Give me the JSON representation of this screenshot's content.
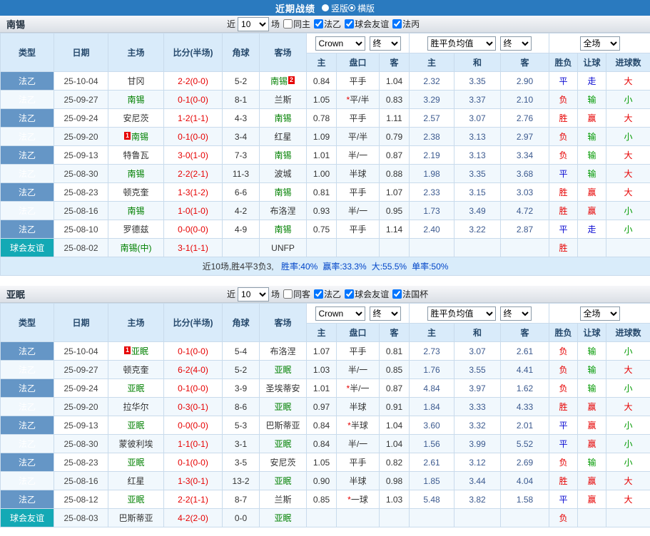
{
  "top_bar": {
    "title": "近期战绩",
    "radios": [
      {
        "label": "竖版",
        "selected": false
      },
      {
        "label": "横版",
        "selected": true
      }
    ]
  },
  "colors": {
    "topbar_bg": "#2a7abf",
    "league_type_bg": "#6596c6",
    "friendly_type_bg": "#14a9b5",
    "team_green": "#008000",
    "score_red": "#e60000",
    "header_bg": "#d9ebfa",
    "summary_bg": "#d9ecfa"
  },
  "result_colors": {
    "胜": "#e60000",
    "负": "#e60000",
    "平": "#0a0ad2",
    "赢": "#e60000",
    "输": "#009900",
    "走": "#0a0ad2",
    "大": "#e60000",
    "小": "#009900"
  },
  "table": {
    "left_headers": [
      "类型",
      "日期",
      "主场",
      "比分(半场)",
      "角球",
      "客场"
    ],
    "odds_headers": [
      "主",
      "盘口",
      "客"
    ],
    "avg_headers": [
      "主",
      "和",
      "客"
    ],
    "result_headers": [
      "胜负",
      "让球",
      "进球数"
    ],
    "selects": {
      "source": "Crown",
      "final1": "终",
      "avg": "胜平负均值",
      "final2": "终",
      "scope": "全场"
    }
  },
  "sections": [
    {
      "team": "南锡",
      "near": "近",
      "count": "10",
      "unit": "场",
      "checkboxes": [
        {
          "label": "同主",
          "checked": false
        },
        {
          "label": "法乙",
          "checked": true
        },
        {
          "label": "球会友谊",
          "checked": true
        },
        {
          "label": "法丙",
          "checked": true
        }
      ],
      "rows": [
        {
          "type": "法乙",
          "friendly": false,
          "date": "25-10-04",
          "home": {
            "text": "甘冈",
            "team": false
          },
          "score": "2-2(0-0)",
          "corner": "5-2",
          "away": {
            "text": "南锡",
            "team": true,
            "badge": "2",
            "badge_pos": "after"
          },
          "odds": [
            "0.84",
            "平手",
            "1.04"
          ],
          "avg": [
            "2.32",
            "3.35",
            "2.90"
          ],
          "result": "平",
          "handicap": "走",
          "goals": "大"
        },
        {
          "type": "法乙",
          "friendly": false,
          "date": "25-09-27",
          "home": {
            "text": "南锡",
            "team": true
          },
          "score": "0-1(0-0)",
          "corner": "8-1",
          "away": {
            "text": "兰斯",
            "team": false
          },
          "odds": [
            "1.05",
            "*平/半",
            "0.83"
          ],
          "avg": [
            "3.29",
            "3.37",
            "2.10"
          ],
          "result": "负",
          "handicap": "输",
          "goals": "小"
        },
        {
          "type": "法乙",
          "friendly": false,
          "date": "25-09-24",
          "home": {
            "text": "安尼茨",
            "team": false
          },
          "score": "1-2(1-1)",
          "corner": "4-3",
          "away": {
            "text": "南锡",
            "team": true
          },
          "odds": [
            "0.78",
            "平手",
            "1.11"
          ],
          "avg": [
            "2.57",
            "3.07",
            "2.76"
          ],
          "result": "胜",
          "handicap": "赢",
          "goals": "大"
        },
        {
          "type": "法乙",
          "friendly": false,
          "date": "25-09-20",
          "home": {
            "text": "南锡",
            "team": true,
            "badge": "1",
            "badge_pos": "before"
          },
          "score": "0-1(0-0)",
          "corner": "3-4",
          "away": {
            "text": "红星",
            "team": false
          },
          "odds": [
            "1.09",
            "平/半",
            "0.79"
          ],
          "avg": [
            "2.38",
            "3.13",
            "2.97"
          ],
          "result": "负",
          "handicap": "输",
          "goals": "小"
        },
        {
          "type": "法乙",
          "friendly": false,
          "date": "25-09-13",
          "home": {
            "text": "特鲁瓦",
            "team": false
          },
          "score": "3-0(1-0)",
          "corner": "7-3",
          "away": {
            "text": "南锡",
            "team": true
          },
          "odds": [
            "1.01",
            "半/一",
            "0.87"
          ],
          "avg": [
            "2.19",
            "3.13",
            "3.34"
          ],
          "result": "负",
          "handicap": "输",
          "goals": "大"
        },
        {
          "type": "法乙",
          "friendly": false,
          "date": "25-08-30",
          "home": {
            "text": "南锡",
            "team": true
          },
          "score": "2-2(2-1)",
          "corner": "11-3",
          "away": {
            "text": "波城",
            "team": false
          },
          "odds": [
            "1.00",
            "半球",
            "0.88"
          ],
          "avg": [
            "1.98",
            "3.35",
            "3.68"
          ],
          "result": "平",
          "handicap": "输",
          "goals": "大"
        },
        {
          "type": "法乙",
          "friendly": false,
          "date": "25-08-23",
          "home": {
            "text": "顿克奎",
            "team": false
          },
          "score": "1-3(1-2)",
          "corner": "6-6",
          "away": {
            "text": "南锡",
            "team": true
          },
          "odds": [
            "0.81",
            "平手",
            "1.07"
          ],
          "avg": [
            "2.33",
            "3.15",
            "3.03"
          ],
          "result": "胜",
          "handicap": "赢",
          "goals": "大"
        },
        {
          "type": "法乙",
          "friendly": false,
          "date": "25-08-16",
          "home": {
            "text": "南锡",
            "team": true
          },
          "score": "1-0(1-0)",
          "corner": "4-2",
          "away": {
            "text": "布洛涅",
            "team": false
          },
          "odds": [
            "0.93",
            "半/一",
            "0.95"
          ],
          "avg": [
            "1.73",
            "3.49",
            "4.72"
          ],
          "result": "胜",
          "handicap": "赢",
          "goals": "小"
        },
        {
          "type": "法乙",
          "friendly": false,
          "date": "25-08-10",
          "home": {
            "text": "罗德兹",
            "team": false
          },
          "score": "0-0(0-0)",
          "corner": "4-9",
          "away": {
            "text": "南锡",
            "team": true
          },
          "odds": [
            "0.75",
            "平手",
            "1.14"
          ],
          "avg": [
            "2.40",
            "3.22",
            "2.87"
          ],
          "result": "平",
          "handicap": "走",
          "goals": "小"
        },
        {
          "type": "球会友谊",
          "friendly": true,
          "date": "25-08-02",
          "home": {
            "text": "南锡(中)",
            "team": true
          },
          "score": "3-1(1-1)",
          "corner": "",
          "away": {
            "text": "UNFP",
            "team": false
          },
          "odds": [
            "",
            "",
            ""
          ],
          "avg": [
            "",
            "",
            ""
          ],
          "result": "胜",
          "handicap": "",
          "goals": ""
        }
      ],
      "summary": {
        "prefix": "近10场,胜4平3负3, ",
        "stats": [
          "胜率:40%",
          "赢率:33.3%",
          "大:55.5%",
          "单率:50%"
        ]
      }
    },
    {
      "team": "亚眠",
      "near": "近",
      "count": "10",
      "unit": "场",
      "checkboxes": [
        {
          "label": "同客",
          "checked": false
        },
        {
          "label": "法乙",
          "checked": true
        },
        {
          "label": "球会友谊",
          "checked": true
        },
        {
          "label": "法国杯",
          "checked": true
        }
      ],
      "rows": [
        {
          "type": "法乙",
          "friendly": false,
          "date": "25-10-04",
          "home": {
            "text": "亚眠",
            "team": true,
            "badge": "1",
            "badge_pos": "before"
          },
          "score": "0-1(0-0)",
          "corner": "5-4",
          "away": {
            "text": "布洛涅",
            "team": false
          },
          "odds": [
            "1.07",
            "平手",
            "0.81"
          ],
          "avg": [
            "2.73",
            "3.07",
            "2.61"
          ],
          "result": "负",
          "handicap": "输",
          "goals": "小"
        },
        {
          "type": "法乙",
          "friendly": false,
          "date": "25-09-27",
          "home": {
            "text": "顿克奎",
            "team": false
          },
          "score": "6-2(4-0)",
          "corner": "5-2",
          "away": {
            "text": "亚眠",
            "team": true
          },
          "odds": [
            "1.03",
            "半/一",
            "0.85"
          ],
          "avg": [
            "1.76",
            "3.55",
            "4.41"
          ],
          "result": "负",
          "handicap": "输",
          "goals": "大"
        },
        {
          "type": "法乙",
          "friendly": false,
          "date": "25-09-24",
          "home": {
            "text": "亚眠",
            "team": true
          },
          "score": "0-1(0-0)",
          "corner": "3-9",
          "away": {
            "text": "圣埃蒂安",
            "team": false
          },
          "odds": [
            "1.01",
            "*半/一",
            "0.87"
          ],
          "avg": [
            "4.84",
            "3.97",
            "1.62"
          ],
          "result": "负",
          "handicap": "输",
          "goals": "小"
        },
        {
          "type": "法乙",
          "friendly": false,
          "date": "25-09-20",
          "home": {
            "text": "拉华尔",
            "team": false
          },
          "score": "0-3(0-1)",
          "corner": "8-6",
          "away": {
            "text": "亚眠",
            "team": true
          },
          "odds": [
            "0.97",
            "半球",
            "0.91"
          ],
          "avg": [
            "1.84",
            "3.33",
            "4.33"
          ],
          "result": "胜",
          "handicap": "赢",
          "goals": "大"
        },
        {
          "type": "法乙",
          "friendly": false,
          "date": "25-09-13",
          "home": {
            "text": "亚眠",
            "team": true
          },
          "score": "0-0(0-0)",
          "corner": "5-3",
          "away": {
            "text": "巴斯蒂亚",
            "team": false
          },
          "odds": [
            "0.84",
            "*半球",
            "1.04"
          ],
          "avg": [
            "3.60",
            "3.32",
            "2.01"
          ],
          "result": "平",
          "handicap": "赢",
          "goals": "小"
        },
        {
          "type": "法乙",
          "friendly": false,
          "date": "25-08-30",
          "home": {
            "text": "蒙彼利埃",
            "team": false
          },
          "score": "1-1(0-1)",
          "corner": "3-1",
          "away": {
            "text": "亚眠",
            "team": true
          },
          "odds": [
            "0.84",
            "半/一",
            "1.04"
          ],
          "avg": [
            "1.56",
            "3.99",
            "5.52"
          ],
          "result": "平",
          "handicap": "赢",
          "goals": "小"
        },
        {
          "type": "法乙",
          "friendly": false,
          "date": "25-08-23",
          "home": {
            "text": "亚眠",
            "team": true
          },
          "score": "0-1(0-0)",
          "corner": "3-5",
          "away": {
            "text": "安尼茨",
            "team": false
          },
          "odds": [
            "1.05",
            "平手",
            "0.82"
          ],
          "avg": [
            "2.61",
            "3.12",
            "2.69"
          ],
          "result": "负",
          "handicap": "输",
          "goals": "小"
        },
        {
          "type": "法乙",
          "friendly": false,
          "date": "25-08-16",
          "home": {
            "text": "红星",
            "team": false
          },
          "score": "1-3(0-1)",
          "corner": "13-2",
          "away": {
            "text": "亚眠",
            "team": true
          },
          "odds": [
            "0.90",
            "半球",
            "0.98"
          ],
          "avg": [
            "1.85",
            "3.44",
            "4.04"
          ],
          "result": "胜",
          "handicap": "赢",
          "goals": "大"
        },
        {
          "type": "法乙",
          "friendly": false,
          "date": "25-08-12",
          "home": {
            "text": "亚眠",
            "team": true
          },
          "score": "2-2(1-1)",
          "corner": "8-7",
          "away": {
            "text": "兰斯",
            "team": false
          },
          "odds": [
            "0.85",
            "*一球",
            "1.03"
          ],
          "avg": [
            "5.48",
            "3.82",
            "1.58"
          ],
          "result": "平",
          "handicap": "赢",
          "goals": "大"
        },
        {
          "type": "球会友谊",
          "friendly": true,
          "date": "25-08-03",
          "home": {
            "text": "巴斯蒂亚",
            "team": false
          },
          "score": "4-2(2-0)",
          "corner": "0-0",
          "away": {
            "text": "亚眠",
            "team": true
          },
          "odds": [
            "",
            "",
            ""
          ],
          "avg": [
            "",
            "",
            ""
          ],
          "result": "负",
          "handicap": "",
          "goals": ""
        }
      ],
      "summary": null
    }
  ]
}
